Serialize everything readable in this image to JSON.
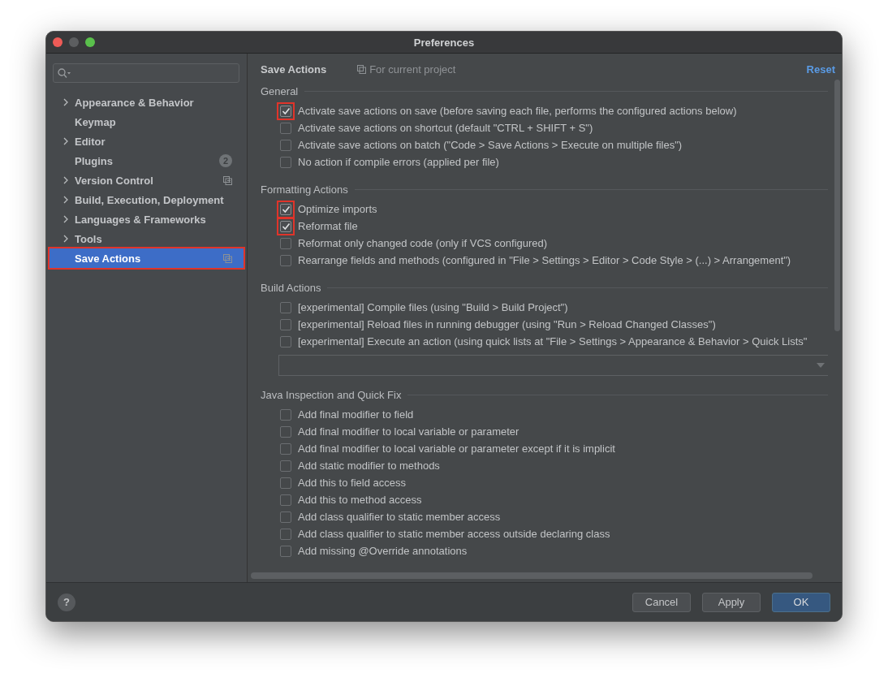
{
  "window": {
    "title": "Preferences"
  },
  "sidebar": {
    "items": [
      {
        "label": "Appearance & Behavior",
        "has_children": true,
        "selected": false,
        "highlighted": false
      },
      {
        "label": "Keymap",
        "has_children": false,
        "selected": false,
        "highlighted": false
      },
      {
        "label": "Editor",
        "has_children": true,
        "selected": false,
        "highlighted": false
      },
      {
        "label": "Plugins",
        "has_children": false,
        "selected": false,
        "highlighted": false,
        "badge": "2"
      },
      {
        "label": "Version Control",
        "has_children": true,
        "selected": false,
        "highlighted": false,
        "project_scope": true
      },
      {
        "label": "Build, Execution, Deployment",
        "has_children": true,
        "selected": false,
        "highlighted": false
      },
      {
        "label": "Languages & Frameworks",
        "has_children": true,
        "selected": false,
        "highlighted": false
      },
      {
        "label": "Tools",
        "has_children": true,
        "selected": false,
        "highlighted": false
      },
      {
        "label": "Save Actions",
        "has_children": false,
        "selected": true,
        "highlighted": true,
        "project_scope": true
      }
    ]
  },
  "header": {
    "title": "Save Actions",
    "scope": "For current project",
    "reset": "Reset"
  },
  "sections": [
    {
      "title": "General",
      "items": [
        {
          "kind": "checkbox",
          "label": "Activate save actions on save (before saving each file, performs the configured actions below)",
          "checked": true,
          "highlighted": true
        },
        {
          "kind": "checkbox",
          "label": "Activate save actions on shortcut (default \"CTRL + SHIFT + S\")",
          "checked": false,
          "highlighted": false
        },
        {
          "kind": "checkbox",
          "label": "Activate save actions on batch (\"Code > Save Actions > Execute on multiple files\")",
          "checked": false,
          "highlighted": false
        },
        {
          "kind": "checkbox",
          "label": "No action if compile errors (applied per file)",
          "checked": false,
          "highlighted": false
        }
      ]
    },
    {
      "title": "Formatting Actions",
      "items": [
        {
          "kind": "checkbox",
          "label": "Optimize imports",
          "checked": true,
          "highlighted": true
        },
        {
          "kind": "checkbox",
          "label": "Reformat file",
          "checked": true,
          "highlighted": true
        },
        {
          "kind": "checkbox",
          "label": "Reformat only changed code (only if VCS configured)",
          "checked": false,
          "highlighted": false
        },
        {
          "kind": "checkbox",
          "label": "Rearrange fields and methods (configured in \"File > Settings > Editor > Code Style > (...) > Arrangement\")",
          "checked": false,
          "highlighted": false
        }
      ]
    },
    {
      "title": "Build Actions",
      "items": [
        {
          "kind": "checkbox",
          "label": "[experimental] Compile files (using \"Build > Build Project\")",
          "checked": false,
          "highlighted": false
        },
        {
          "kind": "checkbox",
          "label": "[experimental] Reload files in running debugger (using \"Run > Reload Changed Classes\")",
          "checked": false,
          "highlighted": false
        },
        {
          "kind": "checkbox",
          "label": "[experimental] Execute an action (using quick lists at \"File > Settings > Appearance & Behavior > Quick Lists\"",
          "checked": false,
          "highlighted": false
        },
        {
          "kind": "dropdown"
        }
      ]
    },
    {
      "title": "Java Inspection and Quick Fix",
      "items": [
        {
          "kind": "checkbox",
          "label": "Add final modifier to field",
          "checked": false,
          "highlighted": false
        },
        {
          "kind": "checkbox",
          "label": "Add final modifier to local variable or parameter",
          "checked": false,
          "highlighted": false
        },
        {
          "kind": "checkbox",
          "label": "Add final modifier to local variable or parameter except if it is implicit",
          "checked": false,
          "highlighted": false
        },
        {
          "kind": "checkbox",
          "label": "Add static modifier to methods",
          "checked": false,
          "highlighted": false
        },
        {
          "kind": "checkbox",
          "label": "Add this to field access",
          "checked": false,
          "highlighted": false
        },
        {
          "kind": "checkbox",
          "label": "Add this to method access",
          "checked": false,
          "highlighted": false
        },
        {
          "kind": "checkbox",
          "label": "Add class qualifier to static member access",
          "checked": false,
          "highlighted": false
        },
        {
          "kind": "checkbox",
          "label": "Add class qualifier to static member access outside declaring class",
          "checked": false,
          "highlighted": false
        },
        {
          "kind": "checkbox",
          "label": "Add missing @Override annotations",
          "checked": false,
          "highlighted": false
        }
      ]
    }
  ],
  "footer": {
    "help": "?",
    "buttons": [
      {
        "label": "Cancel",
        "primary": false
      },
      {
        "label": "Apply",
        "primary": false
      },
      {
        "label": "OK",
        "primary": true
      }
    ]
  }
}
